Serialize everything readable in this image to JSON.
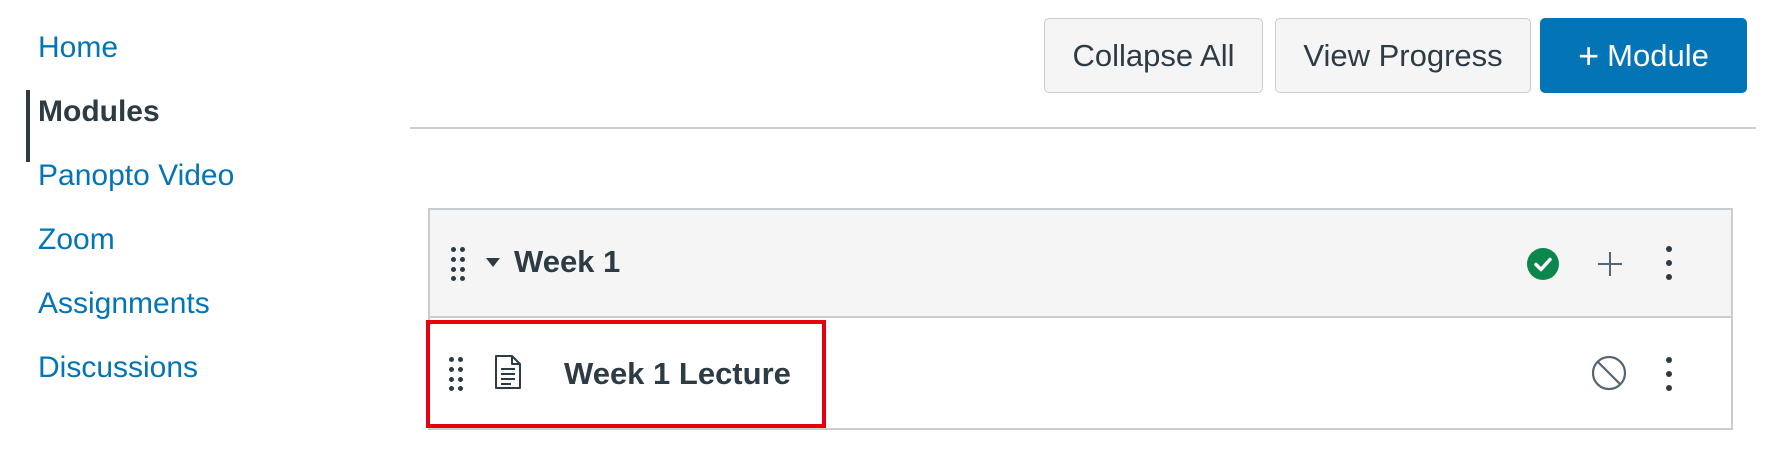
{
  "nav": {
    "items": [
      {
        "label": "Home",
        "active": false
      },
      {
        "label": "Modules",
        "active": true
      },
      {
        "label": "Panopto Video",
        "active": false
      },
      {
        "label": "Zoom",
        "active": false
      },
      {
        "label": "Assignments",
        "active": false
      },
      {
        "label": "Discussions",
        "active": false
      }
    ]
  },
  "toolbar": {
    "collapse_all_label": "Collapse All",
    "view_progress_label": "View Progress",
    "add_module_label": "Module"
  },
  "module": {
    "title": "Week 1",
    "status": "published",
    "status_icon": "check-circle-icon",
    "items": [
      {
        "title": "Week 1 Lecture",
        "type_icon": "page-icon",
        "status": "unpublished",
        "status_icon": "unpublished-icon",
        "highlighted": true
      }
    ]
  },
  "colors": {
    "link": "#0374b5",
    "text": "#2d3b45",
    "primary_button": "#0374b5",
    "published_green": "#0b874b",
    "highlight_red": "#e8000d",
    "header_bg": "#f5f5f5",
    "border": "#c7cdd1"
  }
}
